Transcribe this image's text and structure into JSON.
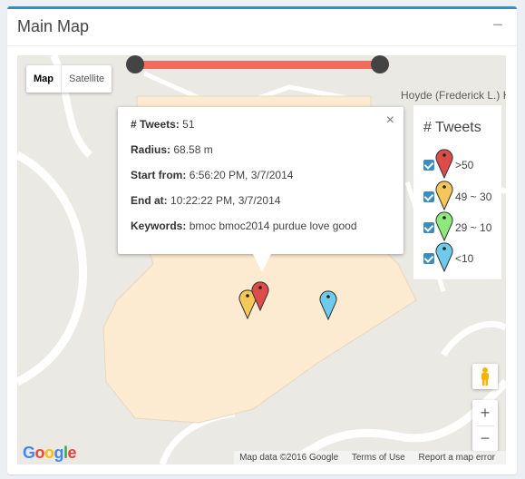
{
  "panel": {
    "title": "Main Map",
    "collapse_label": "−"
  },
  "map": {
    "type_buttons": [
      "Map",
      "Satellite"
    ],
    "active_type": "Map",
    "poi_label": "Hoyde (Frederick L.) Hall of Music",
    "zoom_in": "+",
    "zoom_out": "−",
    "attribution": [
      "Map data ©2016 Google",
      "Terms of Use",
      "Report a map error"
    ],
    "logo": "Google"
  },
  "infowindow": {
    "tweets_label": "# Tweets:",
    "tweets_value": "51",
    "radius_label": "Radius:",
    "radius_value": "68.58 m",
    "start_label": "Start from:",
    "start_value": "6:56:20 PM, 3/7/2014",
    "end_label": "End at:",
    "end_value": "10:22:22 PM, 3/7/2014",
    "keywords_label": "Keywords:",
    "keywords_value": "bmoc bmoc2014 purdue love good",
    "close": "×"
  },
  "legend": {
    "title": "# Tweets",
    "items": [
      {
        "label": ">50",
        "color": "#dd4b4b",
        "icon": "red-pin-icon"
      },
      {
        "label": "49 ~ 30",
        "color": "#f5c75a",
        "icon": "yellow-pin-icon"
      },
      {
        "label": "29 ~ 10",
        "color": "#8fe87a",
        "icon": "green-pin-icon"
      },
      {
        "label": "<10",
        "color": "#6fcbec",
        "icon": "blue-pin-icon"
      }
    ]
  },
  "colors": {
    "accent": "#3c8dbc",
    "slider": "#f26b5b",
    "building": "#fcebd0"
  }
}
